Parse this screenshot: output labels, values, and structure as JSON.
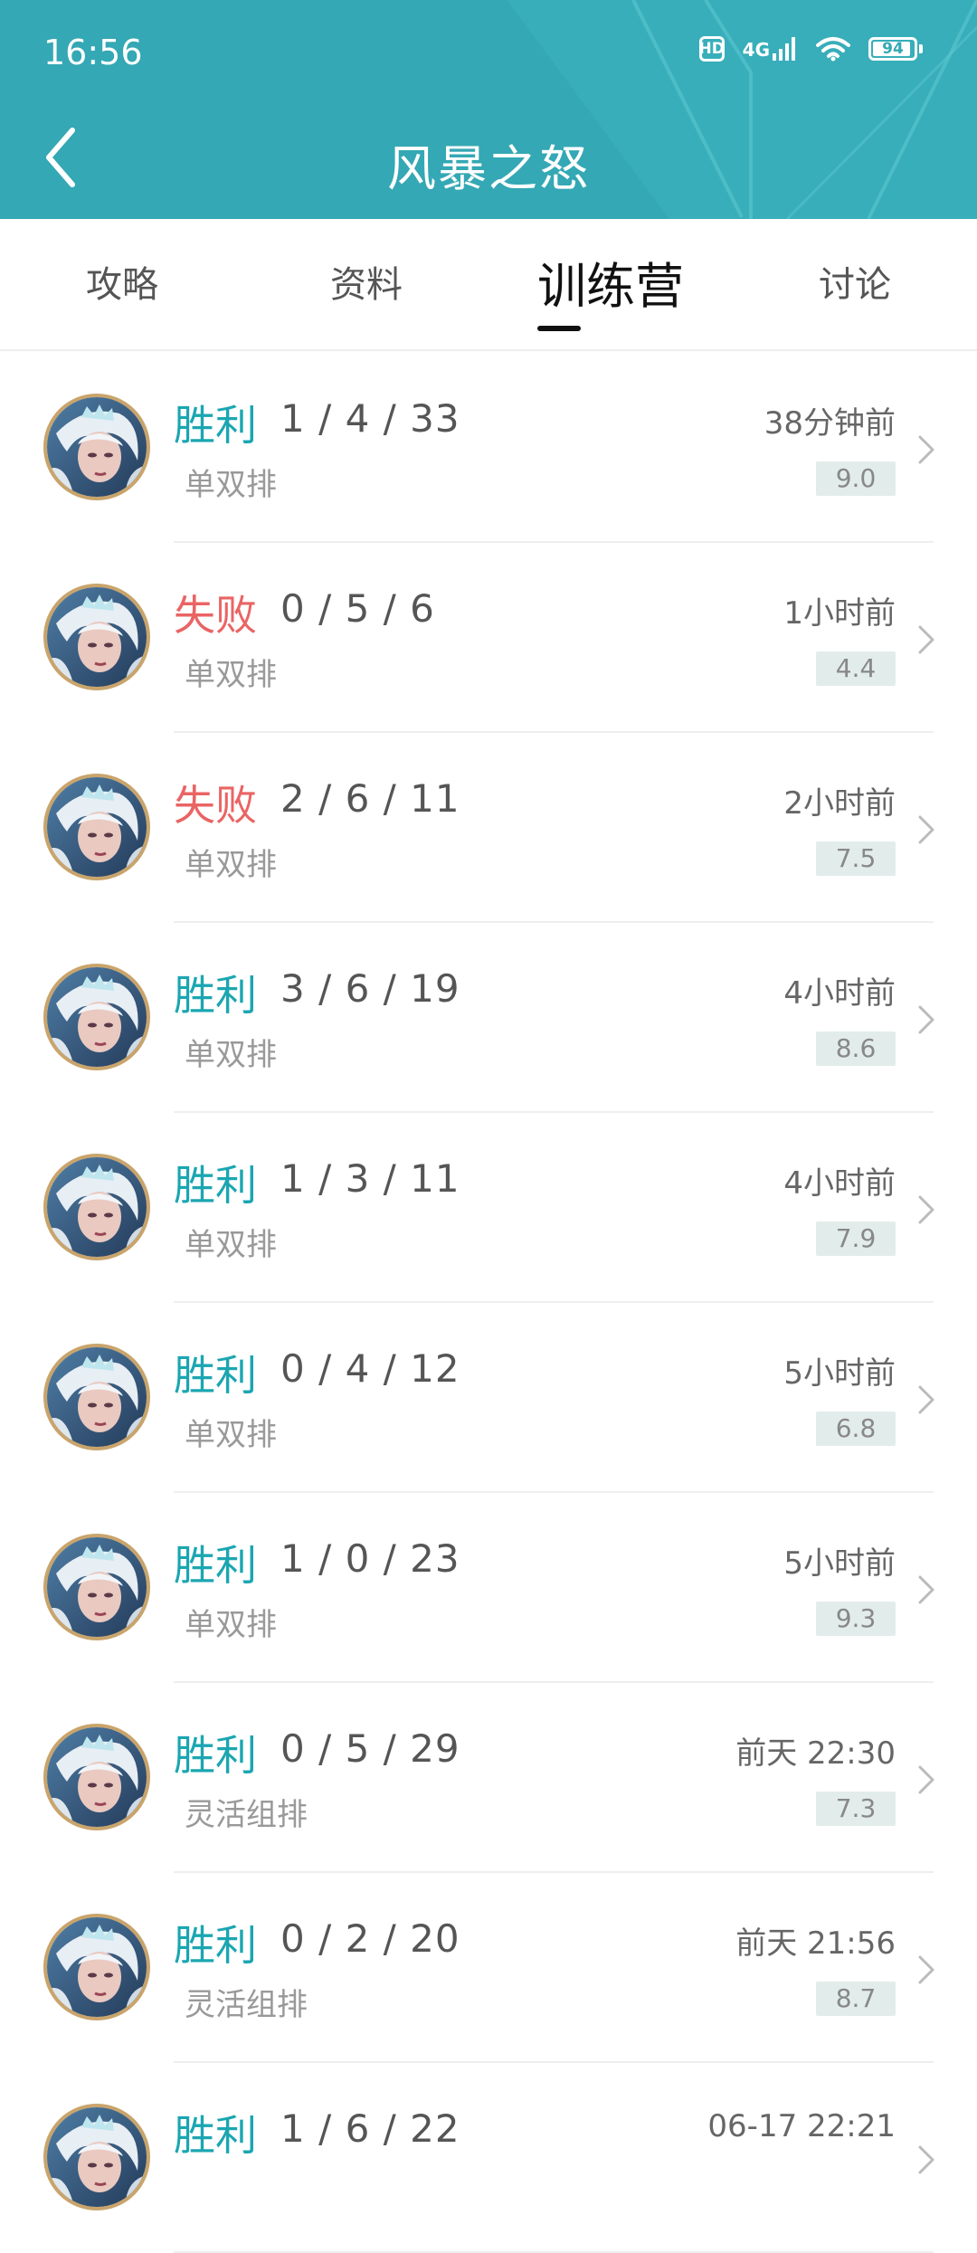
{
  "status_bar": {
    "time": "16:56",
    "hd": "HD",
    "network": "4G",
    "battery": "94",
    "battery_level": 0.94
  },
  "header": {
    "title": "风暴之怒",
    "back_icon": "chevron-left-icon",
    "color": "#34a8b4"
  },
  "tabs": [
    {
      "label": "攻略",
      "active": false
    },
    {
      "label": "资料",
      "active": false
    },
    {
      "label": "训练营",
      "active": true
    },
    {
      "label": "讨论",
      "active": false
    }
  ],
  "colors": {
    "win": "#1ba6b1",
    "loss": "#ea6464",
    "score_bg": "#e2eceb"
  },
  "matches": [
    {
      "result": "胜利",
      "outcome": "win",
      "kda": "1 / 4 / 33",
      "mode": "单双排",
      "time": "38分钟前",
      "score": "9.0"
    },
    {
      "result": "失败",
      "outcome": "loss",
      "kda": "0 / 5 / 6",
      "mode": "单双排",
      "time": "1小时前",
      "score": "4.4"
    },
    {
      "result": "失败",
      "outcome": "loss",
      "kda": "2 / 6 / 11",
      "mode": "单双排",
      "time": "2小时前",
      "score": "7.5"
    },
    {
      "result": "胜利",
      "outcome": "win",
      "kda": "3 / 6 / 19",
      "mode": "单双排",
      "time": "4小时前",
      "score": "8.6"
    },
    {
      "result": "胜利",
      "outcome": "win",
      "kda": "1 / 3 / 11",
      "mode": "单双排",
      "time": "4小时前",
      "score": "7.9"
    },
    {
      "result": "胜利",
      "outcome": "win",
      "kda": "0 / 4 / 12",
      "mode": "单双排",
      "time": "5小时前",
      "score": "6.8"
    },
    {
      "result": "胜利",
      "outcome": "win",
      "kda": "1 / 0 / 23",
      "mode": "单双排",
      "time": "5小时前",
      "score": "9.3"
    },
    {
      "result": "胜利",
      "outcome": "win",
      "kda": "0 / 5 / 29",
      "mode": "灵活组排",
      "time": "前天 22:30",
      "score": "7.3"
    },
    {
      "result": "胜利",
      "outcome": "win",
      "kda": "0 / 2 / 20",
      "mode": "灵活组排",
      "time": "前天 21:56",
      "score": "8.7"
    },
    {
      "result": "胜利",
      "outcome": "win",
      "kda": "1 / 6 / 22",
      "mode": "",
      "time": "06-17 22:21",
      "score": ""
    }
  ]
}
